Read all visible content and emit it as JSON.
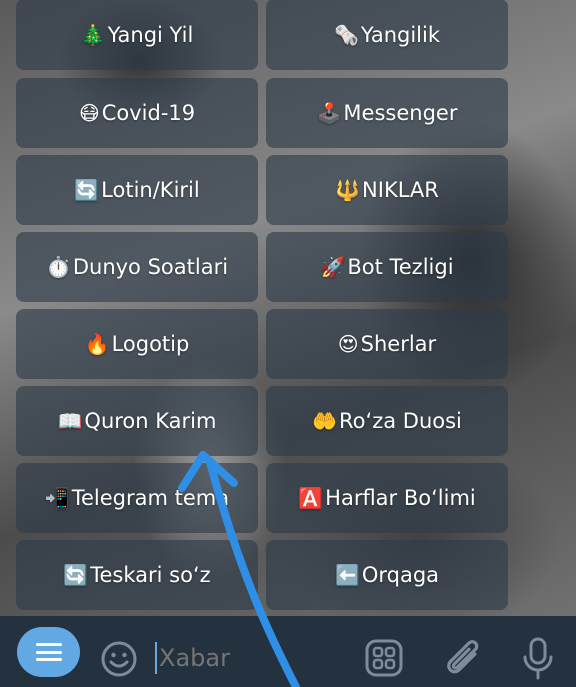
{
  "keyboard": {
    "rows": [
      {
        "left": {
          "emoji": "🎄",
          "label": "Yangi Yil"
        },
        "right": {
          "emoji": "🗞️",
          "label": "Yangilik"
        }
      },
      {
        "left": {
          "emoji": "😷",
          "label": "Covid-19"
        },
        "right": {
          "emoji": "🕹️",
          "label": "Messenger"
        }
      },
      {
        "left": {
          "emoji": "🔄",
          "label": "Lotin/Kiril"
        },
        "right": {
          "emoji": "🔱",
          "label": "NIKLAR"
        }
      },
      {
        "left": {
          "emoji": "⏱️",
          "label": "Dunyo Soatlari"
        },
        "right": {
          "emoji": "🚀",
          "label": "Bot Tezligi"
        }
      },
      {
        "left": {
          "emoji": "🔥",
          "label": "Logotip"
        },
        "right": {
          "emoji": "😍",
          "label": "Sherlar"
        }
      },
      {
        "left": {
          "emoji": "📖",
          "label": "Quron Karim"
        },
        "right": {
          "emoji": "🤲",
          "label": "Ro‘za Duosi"
        }
      },
      {
        "left": {
          "emoji": "📲",
          "label": "Telegram tema"
        },
        "right": {
          "emoji": "🅰️",
          "label": "Harflar Bo‘limi"
        }
      },
      {
        "left": {
          "emoji": "🔄",
          "label": "Teskari so‘z"
        },
        "right": {
          "emoji": "⬅️",
          "label": "Orqaga"
        }
      }
    ]
  },
  "input": {
    "placeholder": "Xabar",
    "accent": "#62a8e3",
    "bar_color": "#24323f"
  },
  "icons": {
    "menu": "menu-icon",
    "emoji": "emoji-smile-icon",
    "bot_commands": "bot-keyboard-icon",
    "attach": "paperclip-icon",
    "mic": "microphone-icon"
  },
  "annotation": {
    "color": "#2f8fe6"
  }
}
